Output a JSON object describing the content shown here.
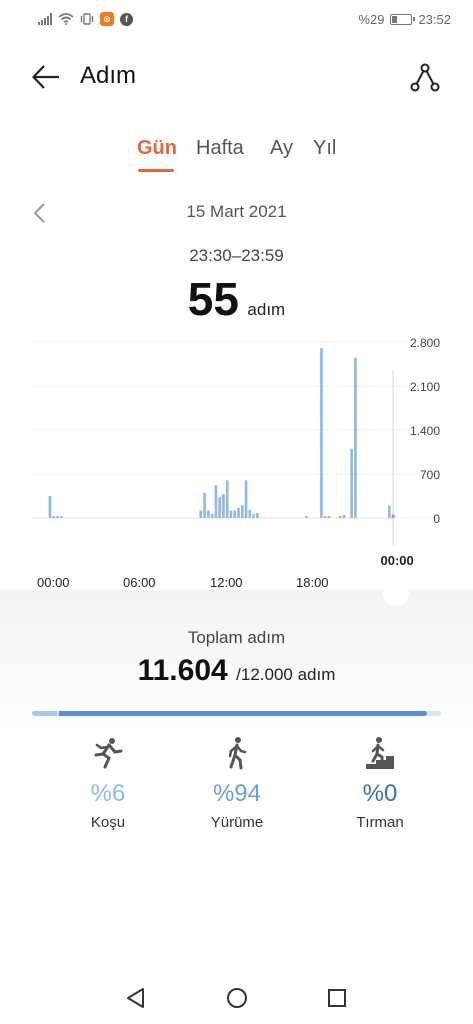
{
  "status_bar": {
    "battery_text": "%29",
    "time": "23:52",
    "notification_icon": "app-notification-icon",
    "facebook_icon": "facebook-icon"
  },
  "header": {
    "title": "Adım",
    "back_icon": "arrow-left-icon",
    "share_icon": "share-route-icon"
  },
  "tabs": [
    {
      "label": "Gün",
      "active": true
    },
    {
      "label": "Hafta",
      "active": false
    },
    {
      "label": "Ay",
      "active": false
    },
    {
      "label": "Yıl",
      "active": false
    }
  ],
  "date": "15 Mart 2021",
  "selection": {
    "time_range": "23:30–23:59",
    "steps": "55",
    "unit": "adım"
  },
  "chart_data": {
    "type": "bar",
    "x_tick_labels": [
      "00:00",
      "06:00",
      "12:00",
      "18:00"
    ],
    "y_tick_labels": [
      "2.800",
      "2.100",
      "1.400",
      "700",
      "0"
    ],
    "ylim": [
      0,
      2800
    ],
    "selected_label": "00:00",
    "bar_color": "#8fb9e6",
    "selected_color": "#3b6fc2",
    "grid": true,
    "values": [
      0,
      0,
      0,
      0,
      350,
      20,
      20,
      20,
      0,
      0,
      0,
      0,
      0,
      0,
      0,
      0,
      0,
      0,
      0,
      0,
      0,
      0,
      0,
      0,
      0,
      0,
      0,
      0,
      0,
      0,
      0,
      0,
      0,
      0,
      0,
      0,
      0,
      0,
      0,
      0,
      0,
      0,
      0,
      0,
      120,
      400,
      120,
      60,
      520,
      330,
      380,
      600,
      120,
      120,
      160,
      200,
      600,
      130,
      60,
      80,
      0,
      0,
      0,
      0,
      0,
      0,
      0,
      0,
      0,
      0,
      0,
      0,
      20,
      0,
      0,
      0,
      2700,
      30,
      30,
      0,
      0,
      30,
      50,
      0,
      1100,
      2550,
      0,
      0,
      0,
      0,
      0,
      0,
      0,
      0,
      200,
      55
    ]
  },
  "summary": {
    "total_label": "Toplam adım",
    "total_value": "11.604",
    "goal_text": "/12.000 adım",
    "progress": 0.967,
    "progress_split": 0.06
  },
  "activities": [
    {
      "label": "Koşu",
      "percent": "%6",
      "icon": "running-icon",
      "color": "#8fb9e6"
    },
    {
      "label": "Yürüme",
      "percent": "%94",
      "icon": "walking-icon",
      "color": "#6c9ddf"
    },
    {
      "label": "Tırman",
      "percent": "%0",
      "icon": "climbing-stairs-icon",
      "color": "#3b6fc2"
    }
  ],
  "nav_bar": {
    "back": "nav-back-icon",
    "home": "nav-home-icon",
    "recents": "nav-recents-icon"
  }
}
